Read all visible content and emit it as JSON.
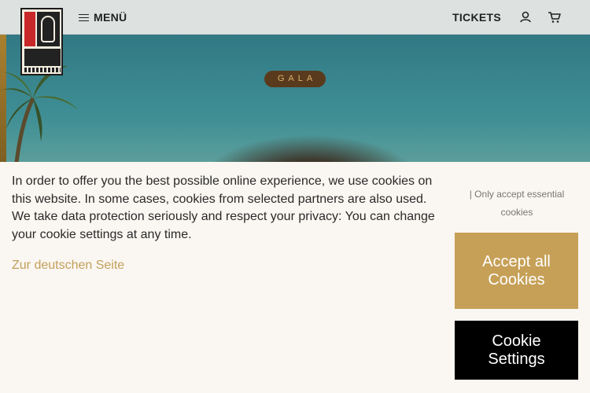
{
  "header": {
    "menu_label": "MENÜ",
    "tickets_label": "TICKETS",
    "user_icon": "user-icon",
    "cart_icon": "cart-icon"
  },
  "hero": {
    "badge": "GALA"
  },
  "cookie_banner": {
    "text": "In order to offer you the best possible online experience, we use cookies on this website. In some cases, cookies from selected partners are also used. We take data protection seriously and respect your privacy: You can change your cookie settings at any time.",
    "german_link": "Zur deutschen Seite",
    "essential_link": "| Only accept essential cookies",
    "accept_label": "Accept all Cookies",
    "settings_label": "Cookie Settings"
  },
  "colors": {
    "accent_gold": "#c6a057",
    "banner_bg": "#faf6f1",
    "settings_bg": "#000000"
  }
}
